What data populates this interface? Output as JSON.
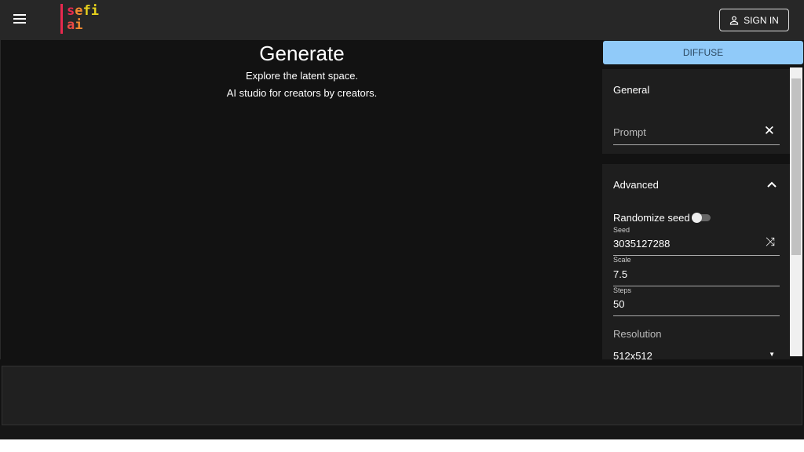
{
  "header": {
    "logo_line1": "sefi",
    "logo_line2": "ai",
    "sign_in": "SIGN IN"
  },
  "main": {
    "title": "Generate",
    "subtitle1": "Explore the latent space.",
    "subtitle2": "AI studio for creators by creators."
  },
  "side": {
    "diffuse": "DIFFUSE",
    "general": "General",
    "prompt_placeholder": "Prompt",
    "advanced": "Advanced",
    "randomize_seed": "Randomize seed",
    "randomize_seed_on": false,
    "seed_label": "Seed",
    "seed": "3035127288",
    "scale_label": "Scale",
    "scale": "7.5",
    "steps_label": "Steps",
    "steps": "50",
    "resolution_label": "Resolution",
    "resolution": "512x512"
  },
  "colors": {
    "accent": "#90caf9",
    "logo_red": "#e8294f",
    "logo_orange": "#f28a30",
    "logo_yellow": "#e6d11c"
  }
}
